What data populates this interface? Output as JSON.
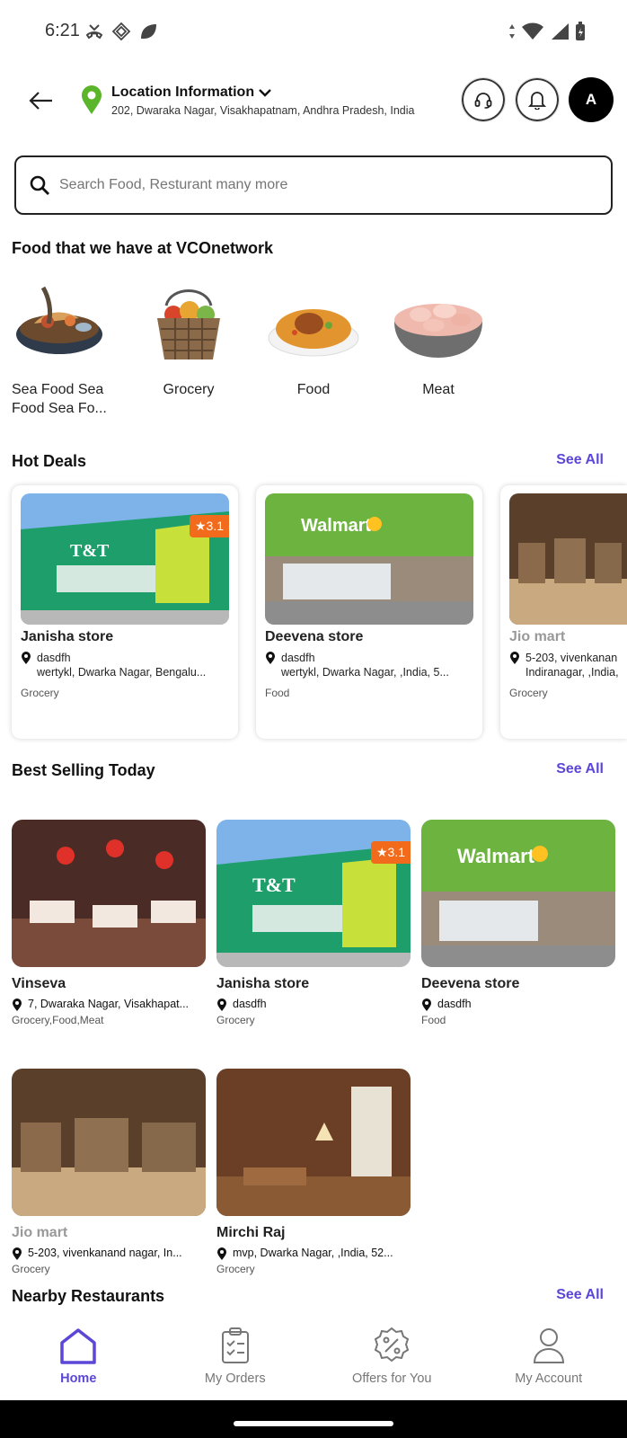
{
  "status": {
    "time": "6:21"
  },
  "header": {
    "location_title": "Location Information",
    "location_address": "202, Dwaraka Nagar, Visakhapatnam, Andhra Pradesh, India",
    "avatar_initial": "A"
  },
  "search": {
    "placeholder": "Search Food, Resturant many more"
  },
  "categories": {
    "title": "Food that we have at VCOnetwork",
    "items": [
      {
        "label": "Sea Food Sea Food Sea Fo..."
      },
      {
        "label": "Grocery"
      },
      {
        "label": "Food"
      },
      {
        "label": "Meat"
      }
    ]
  },
  "hot_deals": {
    "title": "Hot Deals",
    "see_all": "See All",
    "items": [
      {
        "name": "Janisha store",
        "rating": "3.1",
        "addr1": "dasdfh",
        "addr2": "wertykl, Dwarka Nagar, Bengalu...",
        "type": "Grocery"
      },
      {
        "name": "Deevena store",
        "addr1": "dasdfh",
        "addr2": "wertykl, Dwarka Nagar, ,India, 5...",
        "type": "Food"
      },
      {
        "name": "Jio mart",
        "addr1": "5-203, vivenkanan",
        "addr2": "Indiranagar, ,India,",
        "type": "Grocery"
      }
    ]
  },
  "best_selling": {
    "title": "Best Selling Today",
    "see_all": "See All",
    "items": [
      {
        "name": "Vinseva",
        "addr": "7, Dwaraka Nagar, Visakhapat...",
        "type": "Grocery,Food,Meat"
      },
      {
        "name": "Janisha store",
        "rating": "3.1",
        "addr": "dasdfh",
        "type": "Grocery"
      },
      {
        "name": "Deevena store",
        "addr": "dasdfh",
        "type": "Food"
      },
      {
        "name": "Jio mart",
        "addr": "5-203, vivenkanand nagar, In...",
        "type": "Grocery"
      },
      {
        "name": "Mirchi Raj",
        "addr": "mvp, Dwarka Nagar, ,India, 52...",
        "type": "Grocery"
      }
    ]
  },
  "nearby": {
    "title": "Nearby Restaurants",
    "see_all": "See All"
  },
  "bottom_nav": {
    "items": [
      {
        "label": "Home",
        "icon": "home-icon"
      },
      {
        "label": "My Orders",
        "icon": "clipboard-icon"
      },
      {
        "label": "Offers for You",
        "icon": "offer-badge-icon"
      },
      {
        "label": "My Account",
        "icon": "user-icon"
      }
    ]
  },
  "colors": {
    "accent": "#5b46d8",
    "rating": "#f26a1b",
    "pin": "#5ab52a"
  }
}
